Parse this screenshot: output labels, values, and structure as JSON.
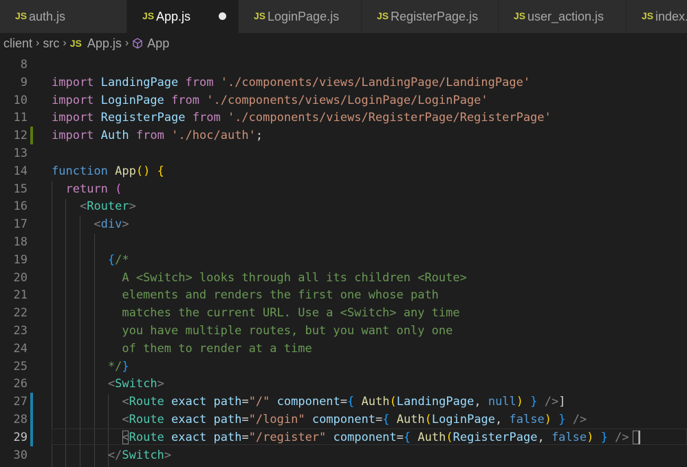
{
  "tabs": [
    {
      "icon": "JS",
      "label": "auth.js"
    },
    {
      "icon": "JS",
      "label": "App.js",
      "unsaved": true
    },
    {
      "icon": "JS",
      "label": "LoginPage.js"
    },
    {
      "icon": "JS",
      "label": "RegisterPage.js"
    },
    {
      "icon": "JS",
      "label": "user_action.js"
    },
    {
      "icon": "JS",
      "label": "index."
    }
  ],
  "breadcrumb": {
    "items": [
      "client",
      "src",
      "App.js",
      "App"
    ],
    "file_icon": "JS"
  },
  "colors": {
    "keyword_blue": "#569cd6",
    "keyword_purple": "#c586c0",
    "string": "#ce9178",
    "tag": "#4ec9b0",
    "comment": "#6a9955",
    "function": "#dcdcaa",
    "variable": "#9cdcfe",
    "gutter_added": "#587c0c",
    "gutter_modified": "#1b81a8"
  },
  "editor": {
    "current_line": "29",
    "lines": [
      {
        "n": "8",
        "text": ""
      },
      {
        "n": "9",
        "text": "import LandingPage from './components/views/LandingPage/LandingPage'"
      },
      {
        "n": "10",
        "text": "import LoginPage from './components/views/LoginPage/LoginPage'"
      },
      {
        "n": "11",
        "text": "import RegisterPage from './components/views/RegisterPage/RegisterPage'"
      },
      {
        "n": "12",
        "text": "import Auth from './hoc/auth';"
      },
      {
        "n": "13",
        "text": ""
      },
      {
        "n": "14",
        "text": "function App() {"
      },
      {
        "n": "15",
        "text": "  return ("
      },
      {
        "n": "16",
        "text": "    <Router>"
      },
      {
        "n": "17",
        "text": "      <div>"
      },
      {
        "n": "18",
        "text": ""
      },
      {
        "n": "19",
        "text": "        {/*"
      },
      {
        "n": "20",
        "text": "          A <Switch> looks through all its children <Route>"
      },
      {
        "n": "21",
        "text": "          elements and renders the first one whose path"
      },
      {
        "n": "22",
        "text": "          matches the current URL. Use a <Switch> any time"
      },
      {
        "n": "23",
        "text": "          you have multiple routes, but you want only one"
      },
      {
        "n": "24",
        "text": "          of them to render at a time"
      },
      {
        "n": "25",
        "text": "        */}"
      },
      {
        "n": "26",
        "text": "        <Switch>"
      },
      {
        "n": "27",
        "text": "          <Route exact path=\"/\" component={ Auth(LandingPage, null) } />]"
      },
      {
        "n": "28",
        "text": "          <Route exact path=\"/login\" component={ Auth(LoginPage, false) } />"
      },
      {
        "n": "29",
        "text": "          <Route exact path=\"/register\" component={ Auth(RegisterPage, false) } />"
      },
      {
        "n": "30",
        "text": "        </Switch>"
      }
    ]
  }
}
